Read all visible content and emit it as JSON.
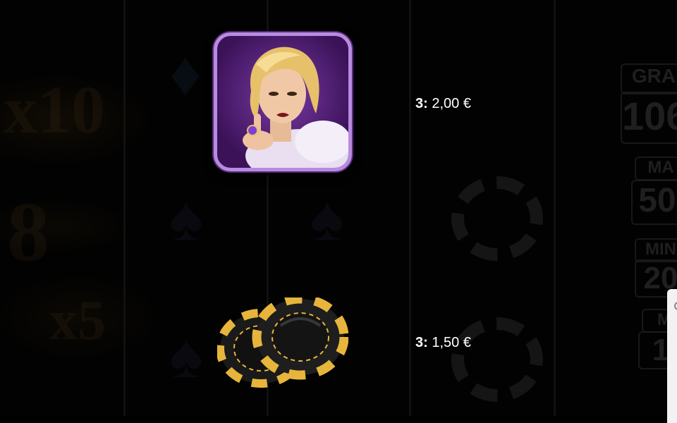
{
  "paytable": {
    "symbols": [
      {
        "name": "blonde-woman",
        "count_label": "3:",
        "value": "2,00 €"
      },
      {
        "name": "casino-chips",
        "count_label": "3:",
        "value": "1,50 €"
      }
    ]
  },
  "background": {
    "multipliers": [
      "x10",
      "8",
      "x5"
    ],
    "jackpot_labels": [
      "GRA",
      "106",
      "MA",
      "50",
      "MIN",
      "20",
      "M",
      "1"
    ]
  },
  "colors": {
    "tile_border": "#b78be0",
    "tile_fill": "#5a2182",
    "chip_gold": "#e7b53b",
    "chip_black": "#1a1a1a"
  }
}
